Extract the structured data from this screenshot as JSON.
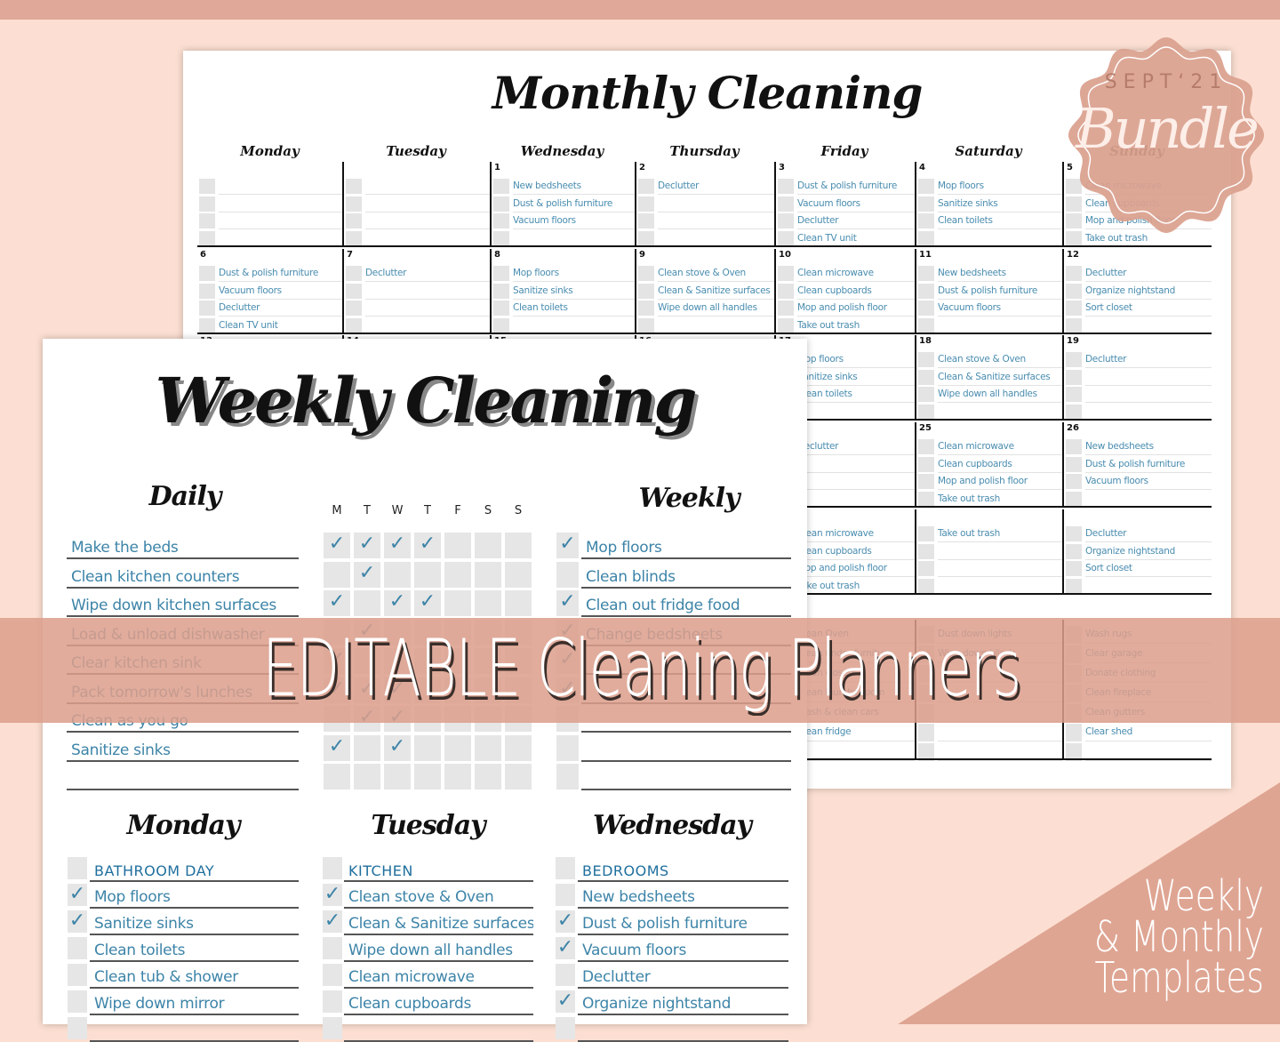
{
  "colors": {
    "background": "#fcdfd2",
    "accent": "#e0a899",
    "task_text": "#3d84a8",
    "banner": "#dc9e8c"
  },
  "monthly": {
    "title": "Monthly Cleaning",
    "days": [
      "Monday",
      "Tuesday",
      "Wednesday",
      "Thursday",
      "Friday",
      "Saturday",
      "Sunday"
    ],
    "weeks": [
      [
        {
          "num": "",
          "tasks": []
        },
        {
          "num": "",
          "tasks": []
        },
        {
          "num": "1",
          "tasks": [
            "New bedsheets",
            "Dust & polish furniture",
            "Vacuum floors"
          ]
        },
        {
          "num": "2",
          "tasks": [
            "Declutter"
          ]
        },
        {
          "num": "3",
          "tasks": [
            "Dust & polish furniture",
            "Vacuum floors",
            "Declutter",
            "Clean TV unit"
          ]
        },
        {
          "num": "4",
          "tasks": [
            "Mop floors",
            "Sanitize sinks",
            "Clean toilets"
          ]
        },
        {
          "num": "5",
          "tasks": [
            "Clean microwave",
            "Clean cupboards",
            "Mop and polish floor",
            "Take out trash"
          ]
        }
      ],
      [
        {
          "num": "6",
          "tasks": [
            "Dust & polish furniture",
            "Vacuum floors",
            "Declutter",
            "Clean TV unit"
          ]
        },
        {
          "num": "7",
          "tasks": [
            "Declutter"
          ]
        },
        {
          "num": "8",
          "tasks": [
            "Mop floors",
            "Sanitize sinks",
            "Clean toilets"
          ]
        },
        {
          "num": "9",
          "tasks": [
            "Clean stove & Oven",
            "Clean & Sanitize surfaces",
            "Wipe down all handles"
          ]
        },
        {
          "num": "10",
          "tasks": [
            "Clean microwave",
            "Clean cupboards",
            "Mop and polish floor",
            "Take out trash"
          ]
        },
        {
          "num": "11",
          "tasks": [
            "New bedsheets",
            "Dust & polish furniture",
            "Vacuum floors"
          ]
        },
        {
          "num": "12",
          "tasks": [
            "Declutter",
            "Organize nightstand",
            "Sort closet"
          ]
        }
      ],
      [
        {
          "num": "13",
          "tasks": []
        },
        {
          "num": "14",
          "tasks": []
        },
        {
          "num": "15",
          "tasks": []
        },
        {
          "num": "16",
          "tasks": []
        },
        {
          "num": "17",
          "tasks": [
            "Mop floors",
            "Sanitize sinks",
            "Clean toilets"
          ]
        },
        {
          "num": "18",
          "tasks": [
            "Clean stove & Oven",
            "Clean & Sanitize surfaces",
            "Wipe down all handles"
          ]
        },
        {
          "num": "19",
          "tasks": [
            "Declutter"
          ]
        }
      ],
      [
        {
          "num": "",
          "tasks": []
        },
        {
          "num": "",
          "tasks": []
        },
        {
          "num": "",
          "tasks": []
        },
        {
          "num": "",
          "tasks": []
        },
        {
          "num": "",
          "tasks": [
            "Declutter"
          ]
        },
        {
          "num": "25",
          "tasks": [
            "Clean microwave",
            "Clean cupboards",
            "Mop and polish floor",
            "Take out trash"
          ]
        },
        {
          "num": "26",
          "tasks": [
            "New bedsheets",
            "Dust & polish furniture",
            "Vacuum floors"
          ]
        }
      ],
      [
        {
          "num": "",
          "tasks": []
        },
        {
          "num": "",
          "tasks": []
        },
        {
          "num": "",
          "tasks": []
        },
        {
          "num": "",
          "tasks": []
        },
        {
          "num": "",
          "tasks": [
            "Clean microwave",
            "Clean cupboards",
            "Mop and polish floor",
            "Take out trash"
          ]
        },
        {
          "num": "",
          "tasks": [
            "Take out trash"
          ]
        },
        {
          "num": "",
          "tasks": [
            "Declutter",
            "Organize nightstand",
            "Sort closet"
          ]
        }
      ]
    ],
    "monthly_tasks": [
      [
        "Clean Oven",
        "Clean under furniture",
        "Clean closets",
        "Clean laundry room",
        "Wash & clean cars",
        "Clean fridge",
        ""
      ],
      [
        "Dust down lights",
        "Wipe down blinds",
        "",
        "",
        "",
        "",
        ""
      ],
      [
        "Wash rugs",
        "Clear garage",
        "Donate clothing",
        "Clean fireplace",
        "Clean gutters",
        "Clear shed",
        ""
      ]
    ]
  },
  "weekly": {
    "title": "Weekly Cleaning",
    "daily_header": "Daily",
    "weekday_letters": [
      "M",
      "T",
      "W",
      "T",
      "F",
      "S",
      "S"
    ],
    "daily": [
      {
        "task": "Make the beds",
        "checks": [
          1,
          1,
          1,
          1,
          0,
          0,
          0
        ]
      },
      {
        "task": "Clean kitchen counters",
        "checks": [
          0,
          1,
          0,
          0,
          0,
          0,
          0
        ]
      },
      {
        "task": "Wipe down kitchen surfaces",
        "checks": [
          1,
          0,
          1,
          1,
          0,
          0,
          0
        ]
      },
      {
        "task": "Load & unload dishwasher",
        "checks": [
          0,
          1,
          0,
          0,
          0,
          0,
          0
        ]
      },
      {
        "task": "Clear kitchen sink",
        "checks": [
          1,
          0,
          0,
          0,
          0,
          0,
          0
        ]
      },
      {
        "task": "Pack tomorrow's lunches",
        "checks": [
          1,
          1,
          1,
          0,
          0,
          0,
          0
        ]
      },
      {
        "task": "Clean as you go",
        "checks": [
          0,
          1,
          1,
          0,
          0,
          0,
          0
        ]
      },
      {
        "task": "Sanitize sinks",
        "checks": [
          1,
          0,
          1,
          0,
          0,
          0,
          0
        ]
      },
      {
        "task": "",
        "checks": [
          0,
          0,
          0,
          0,
          0,
          0,
          0
        ]
      }
    ],
    "weekly_header": "Weekly",
    "weekly_tasks": [
      {
        "task": "Mop floors",
        "done": true
      },
      {
        "task": "Clean blinds",
        "done": false
      },
      {
        "task": "Clean out fridge food",
        "done": true
      },
      {
        "task": "Change bedsheets",
        "done": true
      },
      {
        "task": "",
        "done": true
      },
      {
        "task": "",
        "done": true
      },
      {
        "task": "",
        "done": false
      },
      {
        "task": "",
        "done": false
      },
      {
        "task": "",
        "done": false
      }
    ],
    "days": [
      {
        "name": "Monday",
        "heading": "BATHROOM DAY",
        "tasks": [
          {
            "task": "Mop floors",
            "done": true
          },
          {
            "task": "Sanitize sinks",
            "done": true
          },
          {
            "task": "Clean toilets",
            "done": false
          },
          {
            "task": "Clean tub & shower",
            "done": false
          },
          {
            "task": "Wipe down mirror",
            "done": false
          }
        ]
      },
      {
        "name": "Tuesday",
        "heading": "KITCHEN",
        "tasks": [
          {
            "task": "Clean stove & Oven",
            "done": true
          },
          {
            "task": "Clean & Sanitize surfaces",
            "done": true
          },
          {
            "task": "Wipe down all handles",
            "done": false
          },
          {
            "task": "Clean microwave",
            "done": false
          },
          {
            "task": "Clean cupboards",
            "done": false
          }
        ]
      },
      {
        "name": "Wednesday",
        "heading": "BEDROOMS",
        "tasks": [
          {
            "task": "New bedsheets",
            "done": false
          },
          {
            "task": "Dust & polish furniture",
            "done": true
          },
          {
            "task": "Vacuum floors",
            "done": true
          },
          {
            "task": "Declutter",
            "done": false
          },
          {
            "task": "Organize nightstand",
            "done": true
          }
        ]
      }
    ]
  },
  "banner": {
    "text": "EDITABLE Cleaning Planners"
  },
  "badge": {
    "top": "SEPT‘21",
    "main": "Bundle"
  },
  "corner": {
    "line1": "Weekly",
    "line2": "& Monthly",
    "line3": "Templates"
  }
}
